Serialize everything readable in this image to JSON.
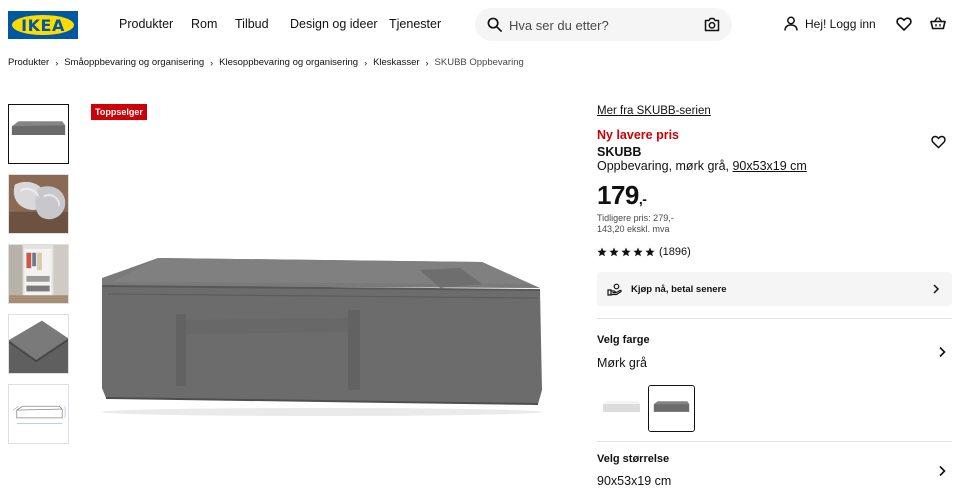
{
  "header": {
    "logo_text": "IKEA",
    "nav": [
      "Produkter",
      "Rom",
      "Tilbud",
      "Design og ideer",
      "Tjenester"
    ],
    "search_placeholder": "Hva ser du etter?",
    "login_label": "Hej! Logg inn",
    "brand_blue": "#0058a3",
    "brand_yellow": "#ffdb00"
  },
  "breadcrumb": [
    "Produkter",
    "Småoppbevaring og organisering",
    "Klesoppbevaring og organisering",
    "Kleskasser",
    "SKUBB Oppbevaring"
  ],
  "gallery": {
    "badge": "Toppselger",
    "badge_color": "#cc0008",
    "thumbnails": [
      "product-front",
      "folded-fabric",
      "wardrobe-room",
      "corner-detail",
      "dimension-drawing"
    ]
  },
  "product": {
    "series_link": "Mer fra SKUBB-serien",
    "new_price_label": "Ny lavere pris",
    "name": "SKUBB",
    "description": "Oppbevaring, mørk grå,",
    "size_link": "90x53x19 cm",
    "price": "179",
    "price_suffix": ",-",
    "previous_price": "Tidligere pris: 279,-",
    "ex_vat": "143,20 ekskl. mva",
    "rating_stars": 5,
    "rating_count": "(1896)",
    "financing_label": "Kjøp nå, betal senere"
  },
  "color_section": {
    "title": "Velg farge",
    "value": "Mørk grå",
    "swatches": [
      "white",
      "dark-grey"
    ],
    "selected": "dark-grey"
  },
  "size_section": {
    "title": "Velg størrelse",
    "value": "90x53x19 cm"
  }
}
